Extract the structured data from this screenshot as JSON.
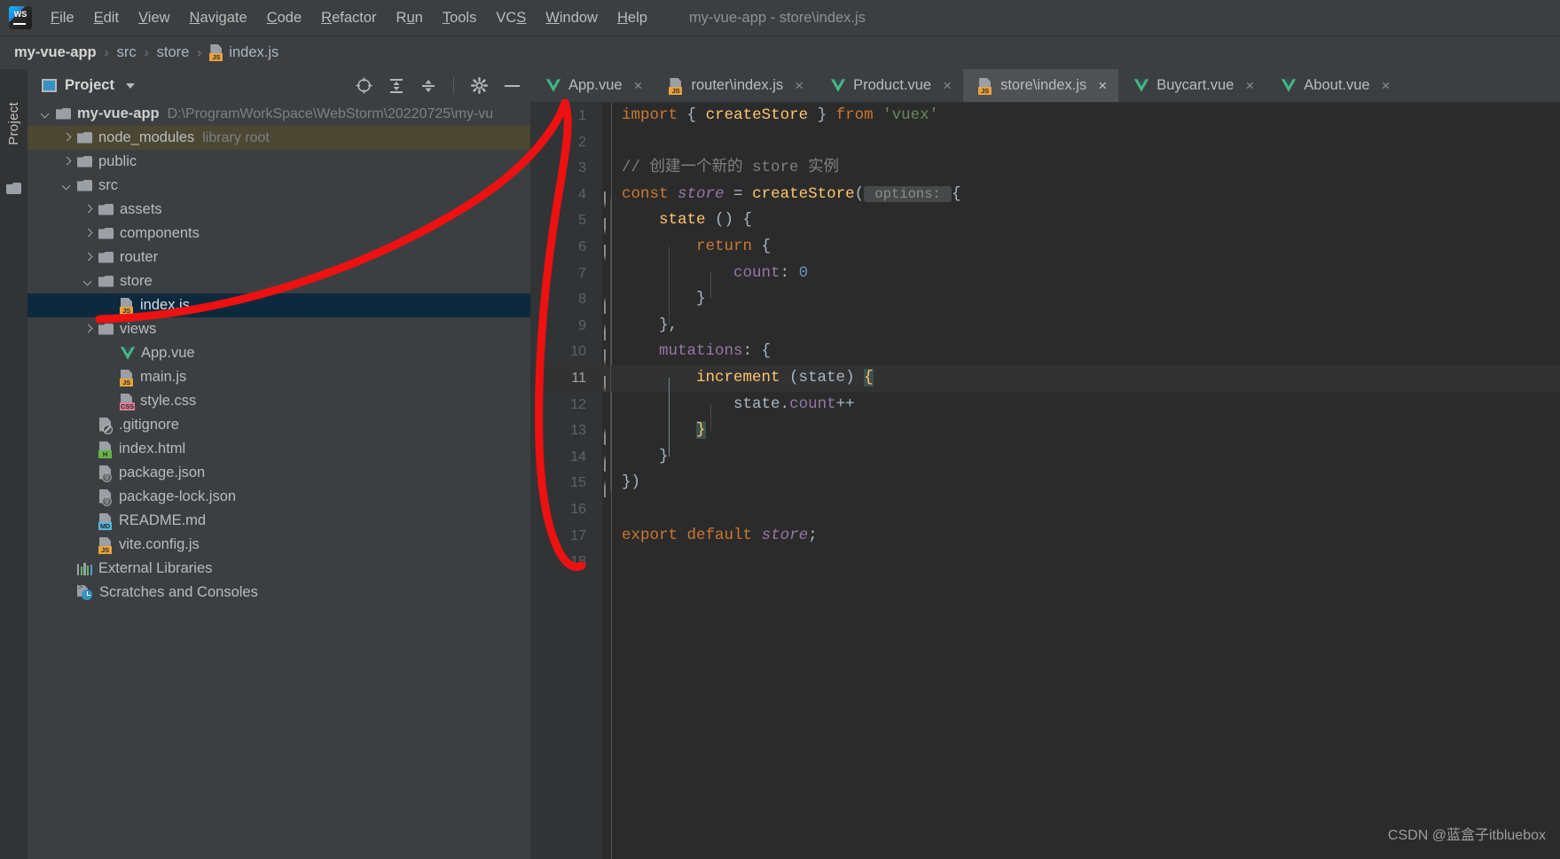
{
  "window": {
    "title": "my-vue-app - store\\index.js",
    "app_logo": "webstorm-logo-icon"
  },
  "menubar": {
    "items": [
      {
        "label": "File",
        "mnemonic": "F"
      },
      {
        "label": "Edit",
        "mnemonic": "E"
      },
      {
        "label": "View",
        "mnemonic": "V"
      },
      {
        "label": "Navigate",
        "mnemonic": "N"
      },
      {
        "label": "Code",
        "mnemonic": "C"
      },
      {
        "label": "Refactor",
        "mnemonic": "R"
      },
      {
        "label": "Run",
        "mnemonic": "u"
      },
      {
        "label": "Tools",
        "mnemonic": "T"
      },
      {
        "label": "VCS",
        "mnemonic": "S"
      },
      {
        "label": "Window",
        "mnemonic": "W"
      },
      {
        "label": "Help",
        "mnemonic": "H"
      }
    ]
  },
  "breadcrumb": {
    "items": [
      {
        "label": "my-vue-app",
        "icon": null,
        "bold": true
      },
      {
        "label": "src",
        "icon": null,
        "bold": false
      },
      {
        "label": "store",
        "icon": null,
        "bold": false
      },
      {
        "label": "index.js",
        "icon": "js-file-icon",
        "bold": false
      }
    ],
    "separator": "›"
  },
  "toolstrip": {
    "project_tab_label": "Project",
    "folder_icon": "folder-icon"
  },
  "project_panel": {
    "title": "Project",
    "dropdown_icon": "chevron-down-icon",
    "toolbar_icons": [
      "locate-target-icon",
      "expand-all-icon",
      "collapse-all-icon",
      "settings-gear-icon",
      "hide-minimize-icon"
    ],
    "tree": [
      {
        "label": "my-vue-app",
        "sub": "D:\\ProgramWorkSpace\\WebStorm\\20220725\\my-vu",
        "indent": 0,
        "arrow": "down",
        "icon": "folder-icon",
        "bold": true,
        "highlight": "none"
      },
      {
        "label": "node_modules",
        "sub": "library root",
        "indent": 1,
        "arrow": "right",
        "icon": "folder-icon",
        "bold": false,
        "highlight": "brown"
      },
      {
        "label": "public",
        "sub": "",
        "indent": 1,
        "arrow": "right",
        "icon": "folder-icon",
        "bold": false,
        "highlight": "none"
      },
      {
        "label": "src",
        "sub": "",
        "indent": 1,
        "arrow": "down",
        "icon": "folder-icon",
        "bold": false,
        "highlight": "none"
      },
      {
        "label": "assets",
        "sub": "",
        "indent": 2,
        "arrow": "right",
        "icon": "folder-icon",
        "bold": false,
        "highlight": "none"
      },
      {
        "label": "components",
        "sub": "",
        "indent": 2,
        "arrow": "right",
        "icon": "folder-icon",
        "bold": false,
        "highlight": "none"
      },
      {
        "label": "router",
        "sub": "",
        "indent": 2,
        "arrow": "right",
        "icon": "folder-icon",
        "bold": false,
        "highlight": "none"
      },
      {
        "label": "store",
        "sub": "",
        "indent": 2,
        "arrow": "down",
        "icon": "folder-icon",
        "bold": false,
        "highlight": "none"
      },
      {
        "label": "index.js",
        "sub": "",
        "indent": 3,
        "arrow": "none",
        "icon": "js-file-icon",
        "bold": false,
        "highlight": "selected"
      },
      {
        "label": "views",
        "sub": "",
        "indent": 2,
        "arrow": "right",
        "icon": "folder-icon",
        "bold": false,
        "highlight": "none"
      },
      {
        "label": "App.vue",
        "sub": "",
        "indent": 3,
        "arrow": "none",
        "icon": "vue-file-icon",
        "bold": false,
        "highlight": "none"
      },
      {
        "label": "main.js",
        "sub": "",
        "indent": 3,
        "arrow": "none",
        "icon": "js-file-icon",
        "bold": false,
        "highlight": "none"
      },
      {
        "label": "style.css",
        "sub": "",
        "indent": 3,
        "arrow": "none",
        "icon": "css-file-icon",
        "bold": false,
        "highlight": "none"
      },
      {
        "label": ".gitignore",
        "sub": "",
        "indent": 2,
        "arrow": "none",
        "icon": "gitignore-file-icon",
        "bold": false,
        "highlight": "none"
      },
      {
        "label": "index.html",
        "sub": "",
        "indent": 2,
        "arrow": "none",
        "icon": "html-file-icon",
        "bold": false,
        "highlight": "none"
      },
      {
        "label": "package.json",
        "sub": "",
        "indent": 2,
        "arrow": "none",
        "icon": "json-file-icon",
        "bold": false,
        "highlight": "none"
      },
      {
        "label": "package-lock.json",
        "sub": "",
        "indent": 2,
        "arrow": "none",
        "icon": "json-file-icon",
        "bold": false,
        "highlight": "none"
      },
      {
        "label": "README.md",
        "sub": "",
        "indent": 2,
        "arrow": "none",
        "icon": "md-file-icon",
        "bold": false,
        "highlight": "none"
      },
      {
        "label": "vite.config.js",
        "sub": "",
        "indent": 2,
        "arrow": "none",
        "icon": "js-file-icon",
        "bold": false,
        "highlight": "none"
      },
      {
        "label": "External Libraries",
        "sub": "",
        "indent": 1,
        "arrow": "none",
        "icon": "libraries-icon",
        "bold": false,
        "highlight": "none"
      },
      {
        "label": "Scratches and Consoles",
        "sub": "",
        "indent": 1,
        "arrow": "none",
        "icon": "scratches-icon",
        "bold": false,
        "highlight": "none"
      }
    ]
  },
  "editor": {
    "tabs": [
      {
        "label": "App.vue",
        "icon": "vue-file-icon",
        "active": false,
        "close": "×"
      },
      {
        "label": "router\\index.js",
        "icon": "js-file-icon",
        "active": false,
        "close": "×"
      },
      {
        "label": "Product.vue",
        "icon": "vue-file-icon",
        "active": false,
        "close": "×"
      },
      {
        "label": "store\\index.js",
        "icon": "js-file-icon",
        "active": true,
        "close": "×"
      },
      {
        "label": "Buycart.vue",
        "icon": "vue-file-icon",
        "active": false,
        "close": "×"
      },
      {
        "label": "About.vue",
        "icon": "vue-file-icon",
        "active": false,
        "close": "×"
      }
    ],
    "current_line": 11,
    "lines": [
      {
        "n": 1,
        "tokens": [
          {
            "t": "import",
            "c": "kw"
          },
          {
            "t": " ",
            "c": "def"
          },
          {
            "t": "{",
            "c": "brace"
          },
          {
            "t": " ",
            "c": "def"
          },
          {
            "t": "createStore",
            "c": "fn"
          },
          {
            "t": " ",
            "c": "def"
          },
          {
            "t": "}",
            "c": "brace"
          },
          {
            "t": " ",
            "c": "def"
          },
          {
            "t": "from",
            "c": "kw"
          },
          {
            "t": " ",
            "c": "def"
          },
          {
            "t": "'vuex'",
            "c": "str"
          }
        ]
      },
      {
        "n": 2,
        "tokens": []
      },
      {
        "n": 3,
        "tokens": [
          {
            "t": "// 创建一个新的 store 实例",
            "c": "cmt"
          }
        ]
      },
      {
        "n": 4,
        "tokens": [
          {
            "t": "const",
            "c": "kw"
          },
          {
            "t": " ",
            "c": "def"
          },
          {
            "t": "store",
            "c": "var"
          },
          {
            "t": " = ",
            "c": "def"
          },
          {
            "t": "createStore",
            "c": "fn"
          },
          {
            "t": "(",
            "c": "brace"
          },
          {
            "t": " options: ",
            "c": "hint"
          },
          {
            "t": "{",
            "c": "brace"
          }
        ]
      },
      {
        "n": 5,
        "tokens": [
          {
            "t": "    ",
            "c": "def"
          },
          {
            "t": "state",
            "c": "fn"
          },
          {
            "t": " () {",
            "c": "brace"
          }
        ]
      },
      {
        "n": 6,
        "tokens": [
          {
            "t": "        ",
            "c": "def"
          },
          {
            "t": "return",
            "c": "kw"
          },
          {
            "t": " {",
            "c": "brace"
          }
        ]
      },
      {
        "n": 7,
        "tokens": [
          {
            "t": "            ",
            "c": "def"
          },
          {
            "t": "count",
            "c": "prop"
          },
          {
            "t": ": ",
            "c": "def"
          },
          {
            "t": "0",
            "c": "num"
          }
        ]
      },
      {
        "n": 8,
        "tokens": [
          {
            "t": "        }",
            "c": "brace"
          }
        ]
      },
      {
        "n": 9,
        "tokens": [
          {
            "t": "    },",
            "c": "brace"
          }
        ]
      },
      {
        "n": 10,
        "tokens": [
          {
            "t": "    ",
            "c": "def"
          },
          {
            "t": "mutations",
            "c": "prop"
          },
          {
            "t": ": {",
            "c": "brace"
          }
        ]
      },
      {
        "n": 11,
        "tokens": [
          {
            "t": "        ",
            "c": "def"
          },
          {
            "t": "increment",
            "c": "fn"
          },
          {
            "t": " (",
            "c": "brace"
          },
          {
            "t": "state",
            "c": "param"
          },
          {
            "t": ") ",
            "c": "brace"
          },
          {
            "t": "{",
            "c": "match"
          }
        ]
      },
      {
        "n": 12,
        "tokens": [
          {
            "t": "            ",
            "c": "def"
          },
          {
            "t": "state",
            "c": "def"
          },
          {
            "t": ".",
            "c": "def"
          },
          {
            "t": "count",
            "c": "prop"
          },
          {
            "t": "++",
            "c": "def"
          }
        ]
      },
      {
        "n": 13,
        "tokens": [
          {
            "t": "        ",
            "c": "def"
          },
          {
            "t": "}",
            "c": "match"
          }
        ]
      },
      {
        "n": 14,
        "tokens": [
          {
            "t": "    }",
            "c": "brace"
          }
        ]
      },
      {
        "n": 15,
        "tokens": [
          {
            "t": "})",
            "c": "brace"
          }
        ]
      },
      {
        "n": 16,
        "tokens": []
      },
      {
        "n": 17,
        "tokens": [
          {
            "t": "export",
            "c": "kw"
          },
          {
            "t": " ",
            "c": "def"
          },
          {
            "t": "default",
            "c": "kw"
          },
          {
            "t": " ",
            "c": "def"
          },
          {
            "t": "store",
            "c": "var"
          },
          {
            "t": ";",
            "c": "def"
          }
        ]
      },
      {
        "n": 18,
        "tokens": []
      }
    ]
  },
  "annotation": {
    "type": "freehand-red-arrow",
    "color": "#ee1111"
  },
  "watermark": {
    "text": "CSDN @蓝盒子itbluebox"
  },
  "colors": {
    "background": "#3c3f41",
    "editor_bg": "#2b2b2b",
    "gutter_bg": "#313335",
    "selected_row": "#0d293e",
    "library_row": "#4b4732",
    "accent": "#3592c4"
  }
}
